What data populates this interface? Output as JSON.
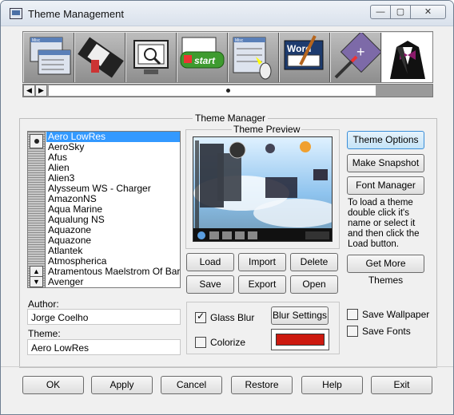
{
  "window": {
    "title": "Theme Management",
    "min_label": "—",
    "max_label": "▢",
    "close_label": "✕"
  },
  "toolbar": {
    "items": [
      {
        "name": "Menu Layout",
        "text": "Misc"
      },
      {
        "name": "Film Strip",
        "text": ""
      },
      {
        "name": "Screensaver",
        "text": ""
      },
      {
        "name": "Start Button",
        "text": "start"
      },
      {
        "name": "Context Menu",
        "text": "Misc"
      },
      {
        "name": "Word Info",
        "text": "Word"
      },
      {
        "name": "Brush Add",
        "text": ""
      },
      {
        "name": "Theme Tux",
        "text": ""
      }
    ],
    "selected_index": 7,
    "scroll_left": "◀",
    "scroll_right": "▶"
  },
  "theme_manager": {
    "group_label": "Theme Manager",
    "preview_label": "Theme Preview",
    "themes": [
      "Aero LowRes",
      "AeroSky",
      "Afus",
      "Alien",
      "Alien3",
      "Alysseum WS - Charger",
      "AmazonNS",
      "Aqua Marine",
      "Aqualung NS",
      "Aquazone",
      "Aquazone",
      "Atlantek",
      "Atmospherica",
      "Atramentous Maelstrom Of Barathrum",
      "Avenger"
    ],
    "selected_theme": "Aero LowRes",
    "list_up": "▲",
    "list_down": "▼",
    "author_label": "Author:",
    "author_value": "Jorge Coelho",
    "theme_label": "Theme:",
    "theme_value": "Aero LowRes",
    "buttons": {
      "load": "Load",
      "import": "Import",
      "delete": "Delete",
      "save": "Save",
      "export": "Export",
      "open": "Open"
    },
    "side_buttons": {
      "theme_options": "Theme Options",
      "make_snapshot": "Make Snapshot",
      "font_manager": "Font Manager",
      "get_more_themes": "Get More Themes"
    },
    "help_text": "To load a theme double click it's name or select it and then click the Load button.",
    "glass_blur_label": "Glass Blur",
    "glass_blur_checked": true,
    "blur_settings": "Blur Settings",
    "colorize_label": "Colorize",
    "colorize_checked": false,
    "colorize_color": "#cc1a10",
    "save_wallpaper_label": "Save Wallpaper",
    "save_fonts_label": "Save Fonts"
  },
  "footer": {
    "ok": "OK",
    "apply": "Apply",
    "cancel": "Cancel",
    "restore": "Restore",
    "help": "Help",
    "exit": "Exit"
  }
}
